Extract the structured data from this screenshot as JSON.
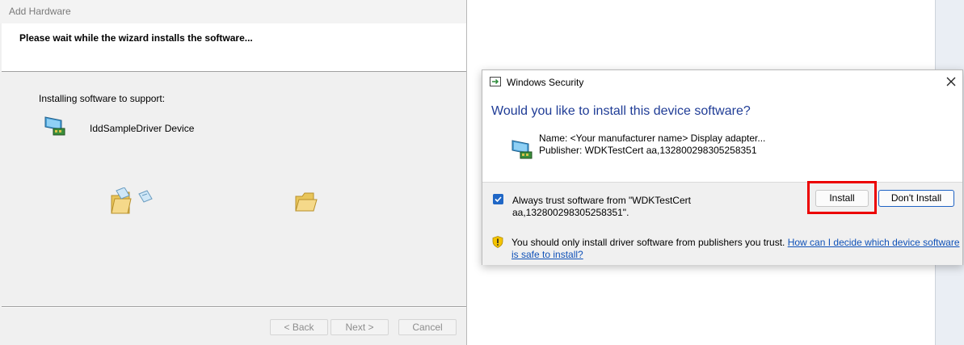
{
  "wizard": {
    "title": "Add Hardware",
    "headline": "Please wait while the wizard installs the software...",
    "installing_label": "Installing software to support:",
    "device_name": "IddSampleDriver Device",
    "device_icon": "display-adapter-icon",
    "anim_icons": [
      "folder-with-document-icon",
      "folder-icon"
    ],
    "buttons": {
      "back": "< Back",
      "next": "Next >",
      "cancel": "Cancel"
    }
  },
  "security": {
    "title": "Windows Security",
    "question": "Would you like to install this device software?",
    "device": {
      "name_line": "Name: <Your manufacturer name> Display adapter...",
      "publisher_line": "Publisher: WDKTestCert aa,132800298305258351"
    },
    "trust_checkbox": {
      "checked": true,
      "label": "Always trust software from \"WDKTestCert aa,132800298305258351\"."
    },
    "buttons": {
      "install": "Install",
      "dont_install": "Don't Install"
    },
    "warning": {
      "text": "You should only install driver software from publishers you trust. ",
      "link": "How can I decide which device software is safe to install?"
    },
    "highlight_color": "#ec0000",
    "accent_color": "#1f3c96"
  }
}
